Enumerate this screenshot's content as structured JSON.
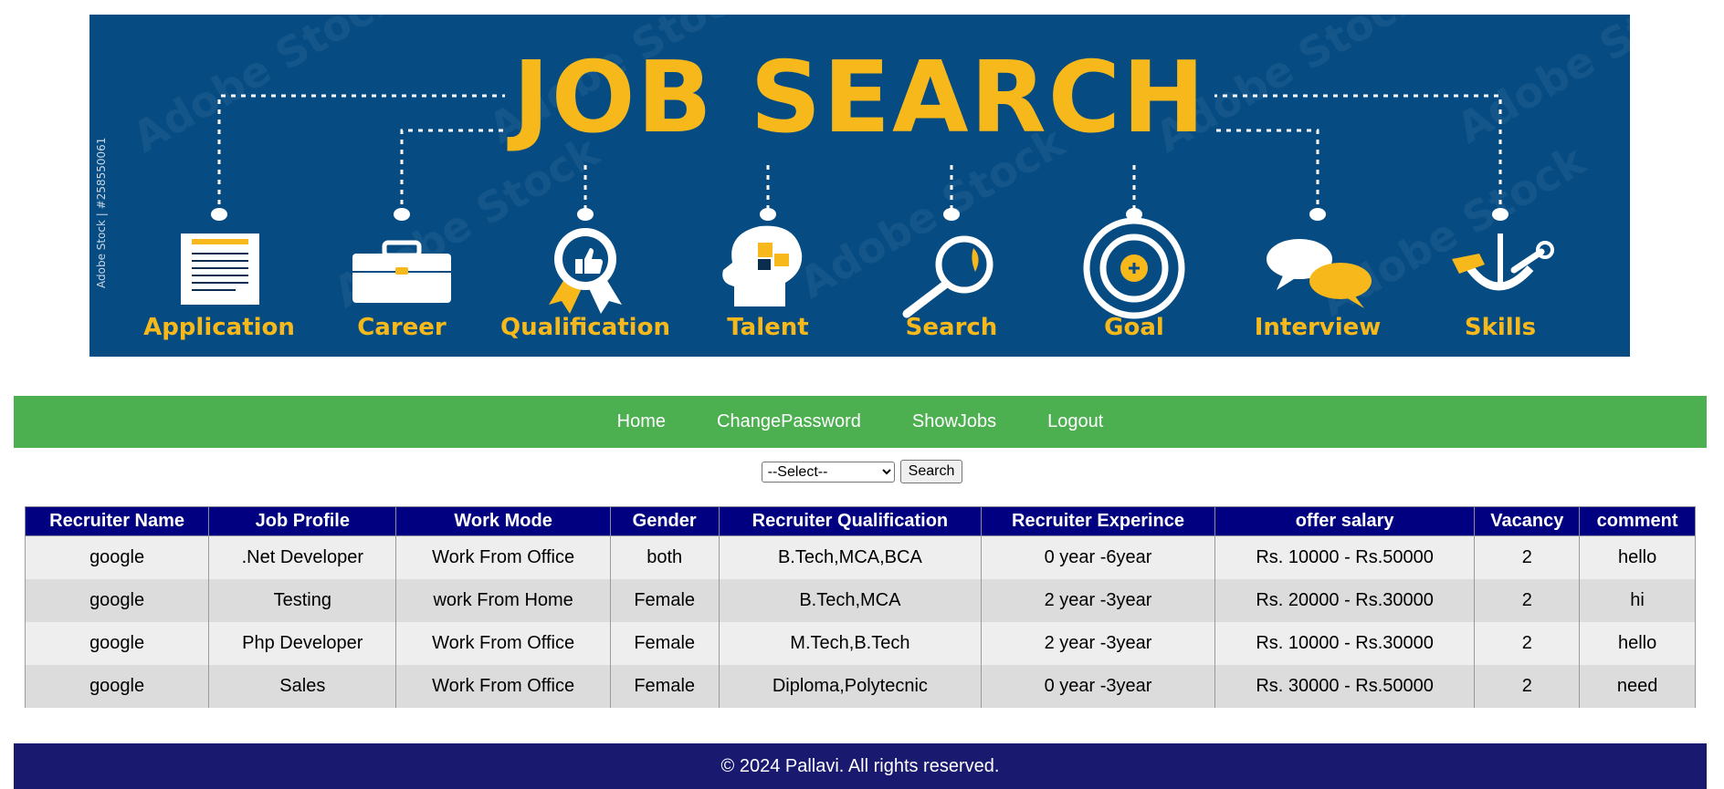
{
  "banner": {
    "title": "JOB SEARCH",
    "side_text": "Adobe Stock | #258550061",
    "watermark": "Adobe Stock",
    "labels": [
      "Application",
      "Career",
      "Qualification",
      "Talent",
      "Search",
      "Goal",
      "Interview",
      "Skills"
    ],
    "icons": [
      "document-icon",
      "briefcase-icon",
      "badge-thumbs-up-icon",
      "head-puzzle-icon",
      "magnifier-icon",
      "target-icon",
      "speech-bubbles-icon",
      "tools-icon"
    ],
    "colors": {
      "background": "#064c82",
      "accent": "#f7b81c"
    }
  },
  "nav": {
    "items": [
      "Home",
      "ChangePassword",
      "ShowJobs",
      "Logout"
    ],
    "color": "#4caf50"
  },
  "search": {
    "select_value": "--Select--",
    "button_label": "Search"
  },
  "table": {
    "headers": [
      "Recruiter Name",
      "Job Profile",
      "Work Mode",
      "Gender",
      "Recruiter Qualification",
      "Recruiter Experince",
      "offer salary",
      "Vacancy",
      "comment"
    ],
    "rows": [
      [
        "google",
        ".Net Developer",
        "Work From Office",
        "both",
        "B.Tech,MCA,BCA",
        "0 year -6year",
        "Rs. 10000 - Rs.50000",
        "2",
        "hello"
      ],
      [
        "google",
        "Testing",
        "work From Home",
        "Female",
        "B.Tech,MCA",
        "2 year -3year",
        "Rs. 20000 - Rs.30000",
        "2",
        "hi"
      ],
      [
        "google",
        "Php Developer",
        "Work From Office",
        "Female",
        "M.Tech,B.Tech",
        "2 year -3year",
        "Rs. 10000 - Rs.30000",
        "2",
        "hello"
      ],
      [
        "google",
        "Sales",
        "Work From Office",
        "Female",
        "Diploma,Polytecnic",
        "0 year -3year",
        "Rs. 30000 - Rs.50000",
        "2",
        "need"
      ]
    ],
    "header_color": "#000080"
  },
  "footer": {
    "text": "© 2024 Pallavi. All rights reserved.",
    "color": "#191970"
  }
}
